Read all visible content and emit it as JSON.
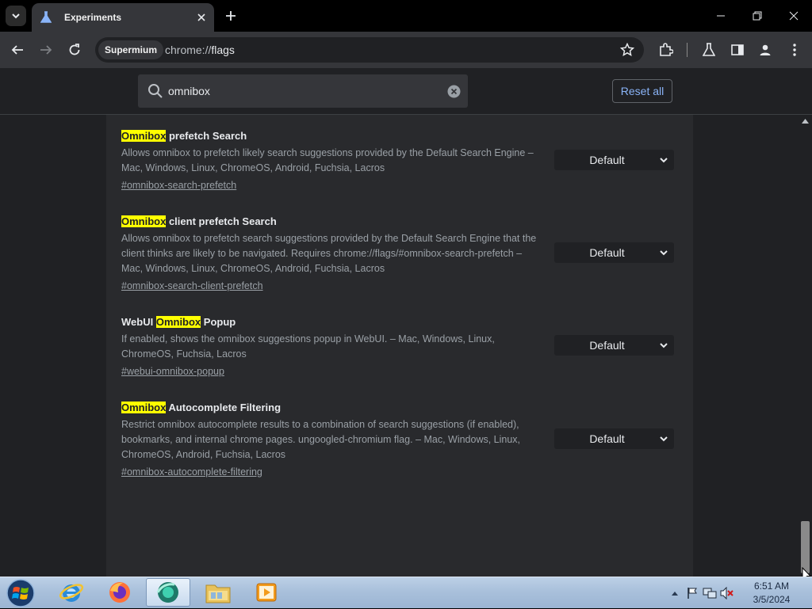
{
  "browser": {
    "tab_title": "Experiments",
    "site_chip": "Supermium",
    "url_scheme": "chrome://",
    "url_path": "flags"
  },
  "flags_page": {
    "search_value": "omnibox",
    "reset_label": "Reset all"
  },
  "experiments": [
    {
      "title_pre": "",
      "title_hl": "Omnibox",
      "title_post": " prefetch Search",
      "description": "Allows omnibox to prefetch likely search suggestions provided by the Default Search Engine – Mac, Windows, Linux, ChromeOS, Android, Fuchsia, Lacros",
      "link": "#omnibox-search-prefetch",
      "select_value": "Default"
    },
    {
      "title_pre": "",
      "title_hl": "Omnibox",
      "title_post": " client prefetch Search",
      "description": "Allows omnibox to prefetch search suggestions provided by the Default Search Engine that the client thinks are likely to be navigated. Requires chrome://flags/#omnibox-search-prefetch – Mac, Windows, Linux, ChromeOS, Android, Fuchsia, Lacros",
      "link": "#omnibox-search-client-prefetch",
      "select_value": "Default"
    },
    {
      "title_pre": "WebUI ",
      "title_hl": "Omnibox",
      "title_post": " Popup",
      "description": "If enabled, shows the omnibox suggestions popup in WebUI. – Mac, Windows, Linux, ChromeOS, Fuchsia, Lacros",
      "link": "#webui-omnibox-popup",
      "select_value": "Default"
    },
    {
      "title_pre": "",
      "title_hl": "Omnibox",
      "title_post": " Autocomplete Filtering",
      "description": "Restrict omnibox autocomplete results to a combination of search suggestions (if enabled), bookmarks, and internal chrome pages. ungoogled-chromium flag. – Mac, Windows, Linux, ChromeOS, Android, Fuchsia, Lacros",
      "link": "#omnibox-autocomplete-filtering",
      "select_value": "Default"
    }
  ],
  "taskbar": {
    "time": "6:51 AM",
    "date": "3/5/2024",
    "apps": [
      "internet-explorer",
      "firefox",
      "supermium",
      "file-explorer",
      "media-player"
    ]
  },
  "colors": {
    "highlight": "#ffff00",
    "link_blue": "#8ab4f8",
    "page_bg": "#202124",
    "panel_bg": "#292a2d"
  }
}
